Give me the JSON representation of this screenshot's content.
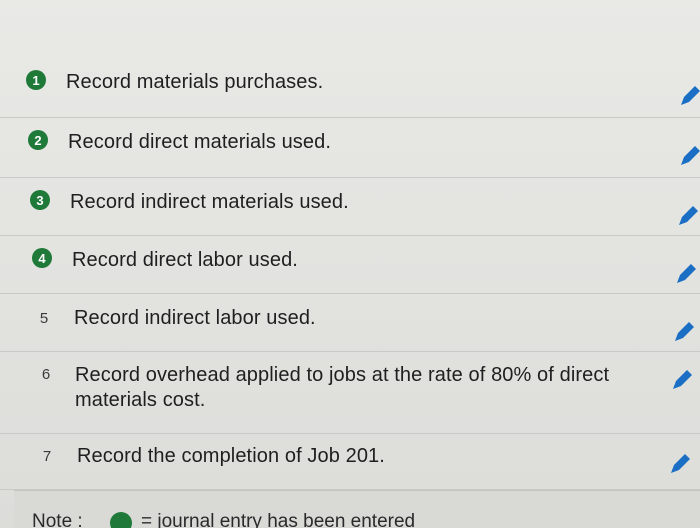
{
  "steps": [
    {
      "number": "1",
      "text": "Record materials purchases.",
      "completed": true
    },
    {
      "number": "2",
      "text": "Record direct materials used.",
      "completed": true
    },
    {
      "number": "3",
      "text": "Record indirect materials used.",
      "completed": true
    },
    {
      "number": "4",
      "text": "Record direct labor used.",
      "completed": true
    },
    {
      "number": "5",
      "text": "Record indirect labor used.",
      "completed": false
    },
    {
      "number": "6",
      "text": "Record overhead applied to jobs at the rate of 80% of direct materials cost.",
      "completed": false
    },
    {
      "number": "7",
      "text": "Record the completion of Job 201.",
      "completed": false
    }
  ],
  "note": {
    "label": "Note :",
    "text": "= journal entry has been entered"
  },
  "colors": {
    "completed": "#1f7a3a",
    "edit_icon": "#1a6fc4",
    "background": "#e7e6e3"
  },
  "icons": {
    "edit": "pencil-icon"
  }
}
